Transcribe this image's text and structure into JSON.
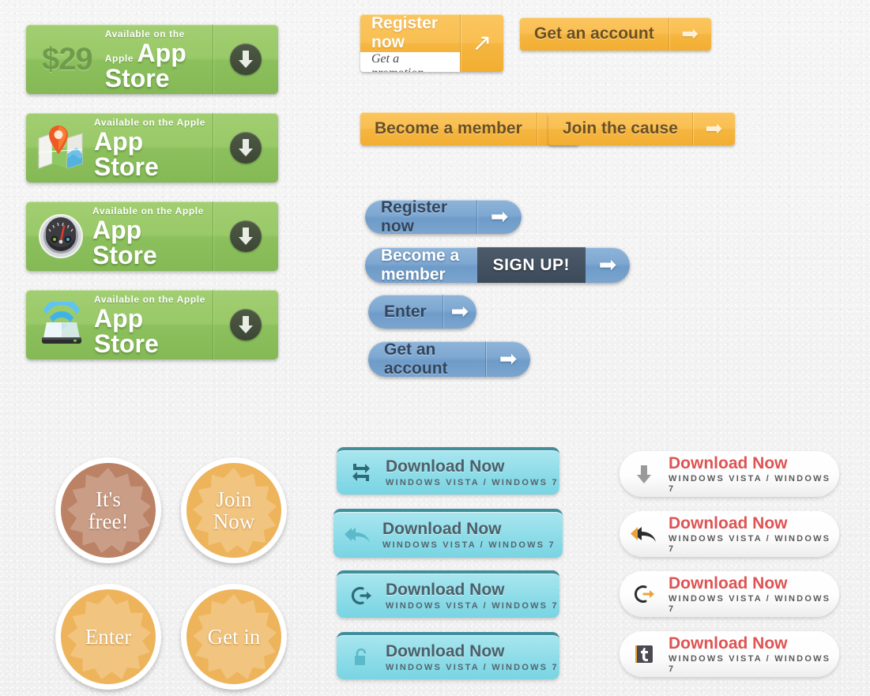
{
  "colors": {
    "green_button": "#93c563",
    "orange_button": "#f7bc4d",
    "blue_button": "#7ea8d2",
    "teal_button": "#8fdde9",
    "teal_top_edge": "#3f8e9b",
    "badge_orange": "#eeb45c",
    "badge_brown": "#bc8265",
    "red_text": "#df5353",
    "dark_chip": "#3d4a59",
    "page_background": "#f2f2f2"
  },
  "appstore_buttons": [
    {
      "price": "$29",
      "icon": "dollar-price",
      "sub": "Available on the Apple",
      "main": "App Store",
      "action_icon": "download-arrow-icon"
    },
    {
      "price": "",
      "icon": "map-pin-icon",
      "sub": "Available on the Apple",
      "main": "App Store",
      "action_icon": "download-arrow-icon"
    },
    {
      "price": "",
      "icon": "gauge-icon",
      "sub": "Available on the Apple",
      "main": "App Store",
      "action_icon": "download-arrow-icon"
    },
    {
      "price": "",
      "icon": "wifi-router-icon",
      "sub": "Available on the Apple",
      "main": "App Store",
      "action_icon": "download-arrow-icon"
    }
  ],
  "orange_buttons": {
    "register": {
      "label": "Register now",
      "promo": "Get a promotion",
      "arrow": "arrow-northeast-icon",
      "arrow_glyph": "↗"
    },
    "get_account": {
      "label": "Get an account",
      "arrow": "arrow-right-icon",
      "arrow_glyph": "➡"
    },
    "become_member": {
      "label": "Become a member",
      "arrow": "arrow-right-icon",
      "arrow_glyph": "➡"
    },
    "join_cause": {
      "label": "Join the cause",
      "arrow": "arrow-right-icon",
      "arrow_glyph": "➡"
    }
  },
  "blue_buttons": [
    {
      "label": "Register now",
      "mid": "",
      "arrow_glyph": "➡"
    },
    {
      "label": "Become a member",
      "mid": "SIGN UP!",
      "arrow_glyph": "➡"
    },
    {
      "label": "Enter",
      "mid": "",
      "arrow_glyph": "➡"
    },
    {
      "label": "Get an account",
      "mid": "",
      "arrow_glyph": "➡"
    }
  ],
  "badges": [
    {
      "line1": "It's",
      "line2": "free!",
      "style": "brown"
    },
    {
      "line1": "Join",
      "line2": "Now",
      "style": "orange"
    },
    {
      "line1": "Enter",
      "line2": "",
      "style": "orange"
    },
    {
      "line1": "Get in",
      "line2": "",
      "style": "orange"
    }
  ],
  "teal_downloads": [
    {
      "icon": "retweet-icon",
      "title": "Download Now",
      "sub": "WINDOWS VISTA / WINDOWS 7"
    },
    {
      "icon": "reply-all-icon",
      "title": "Download Now",
      "sub": "WINDOWS VISTA / WINDOWS 7"
    },
    {
      "icon": "sign-out-icon",
      "title": "Download Now",
      "sub": "WINDOWS VISTA / WINDOWS 7"
    },
    {
      "icon": "lock-icon",
      "title": "Download Now",
      "sub": "WINDOWS VISTA / WINDOWS 7"
    }
  ],
  "white_downloads": [
    {
      "icon": "download-arrow-icon",
      "title": "Download Now",
      "sub": "WINDOWS VISTA / WINDOWS 7"
    },
    {
      "icon": "reply-all-icon",
      "title": "Download Now",
      "sub": "WINDOWS VISTA / WINDOWS 7"
    },
    {
      "icon": "sign-out-icon",
      "title": "Download Now",
      "sub": "WINDOWS VISTA / WINDOWS 7"
    },
    {
      "icon": "tumblr-icon",
      "title": "Download Now",
      "sub": "WINDOWS VISTA / WINDOWS 7"
    }
  ]
}
